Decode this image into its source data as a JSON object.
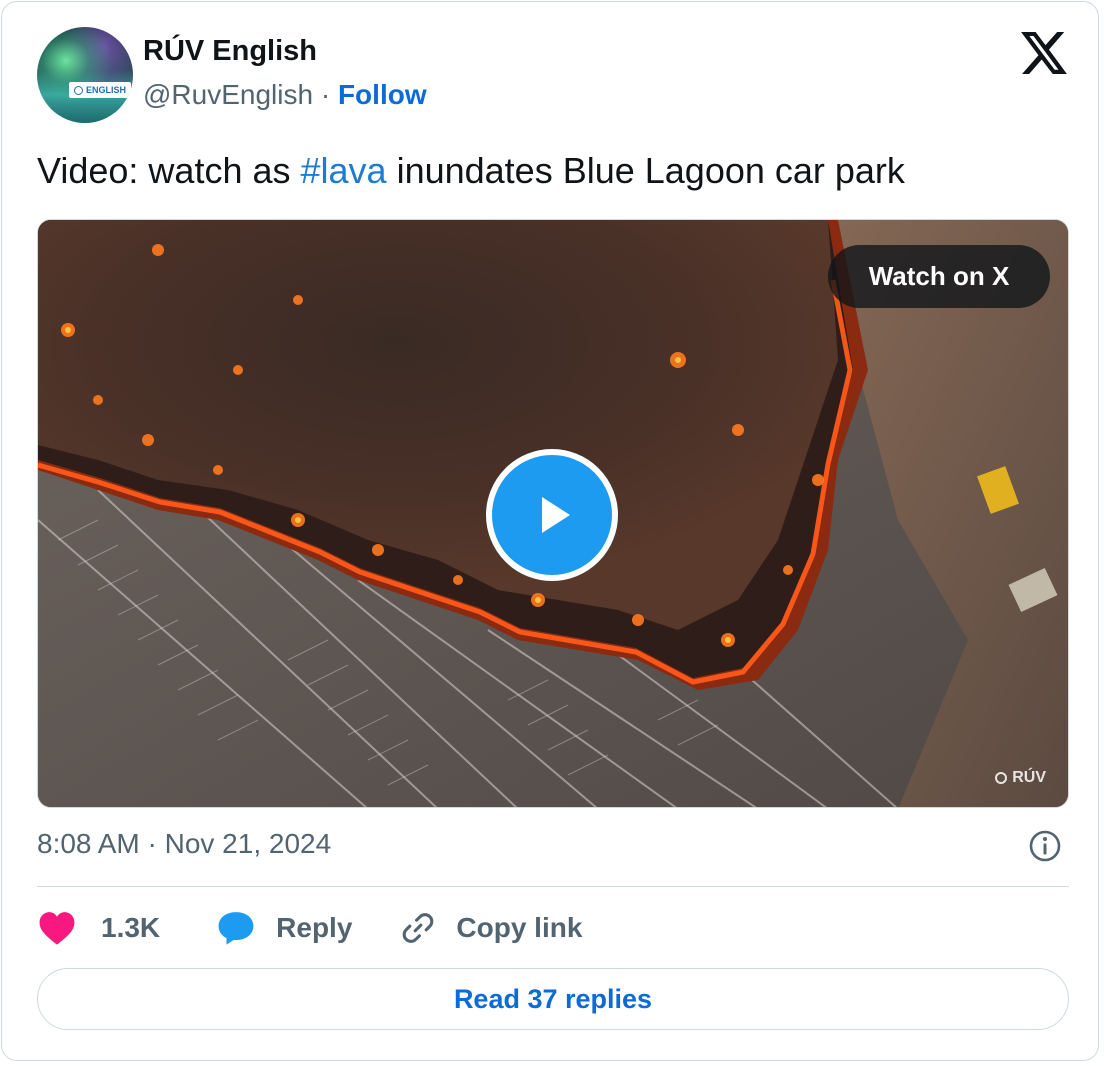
{
  "author": {
    "display_name": "RÚV English",
    "handle": "@RuvEnglish",
    "separator": "·",
    "follow_label": "Follow",
    "avatar_badge_text": "ENGLISH"
  },
  "tweet": {
    "text_before": "Video: watch as ",
    "hashtag": "#lava",
    "text_after": " inundates Blue Lagoon car park"
  },
  "media": {
    "watch_label": "Watch on X",
    "watermark": "RÚV"
  },
  "timestamp": "8:08 AM · Nov 21, 2024",
  "actions": {
    "likes_count": "1.3K",
    "reply_label": "Reply",
    "copy_link_label": "Copy link"
  },
  "read_replies_label": "Read 37 replies",
  "colors": {
    "accent_blue": "#1d9bf0",
    "link_blue": "#0c6bd6",
    "heart_pink": "#f91880",
    "secondary_text": "#536471",
    "border": "#cfd9de"
  },
  "icons": [
    "x-logo-icon",
    "play-icon",
    "info-icon",
    "heart-icon",
    "reply-bubble-icon",
    "link-icon"
  ]
}
